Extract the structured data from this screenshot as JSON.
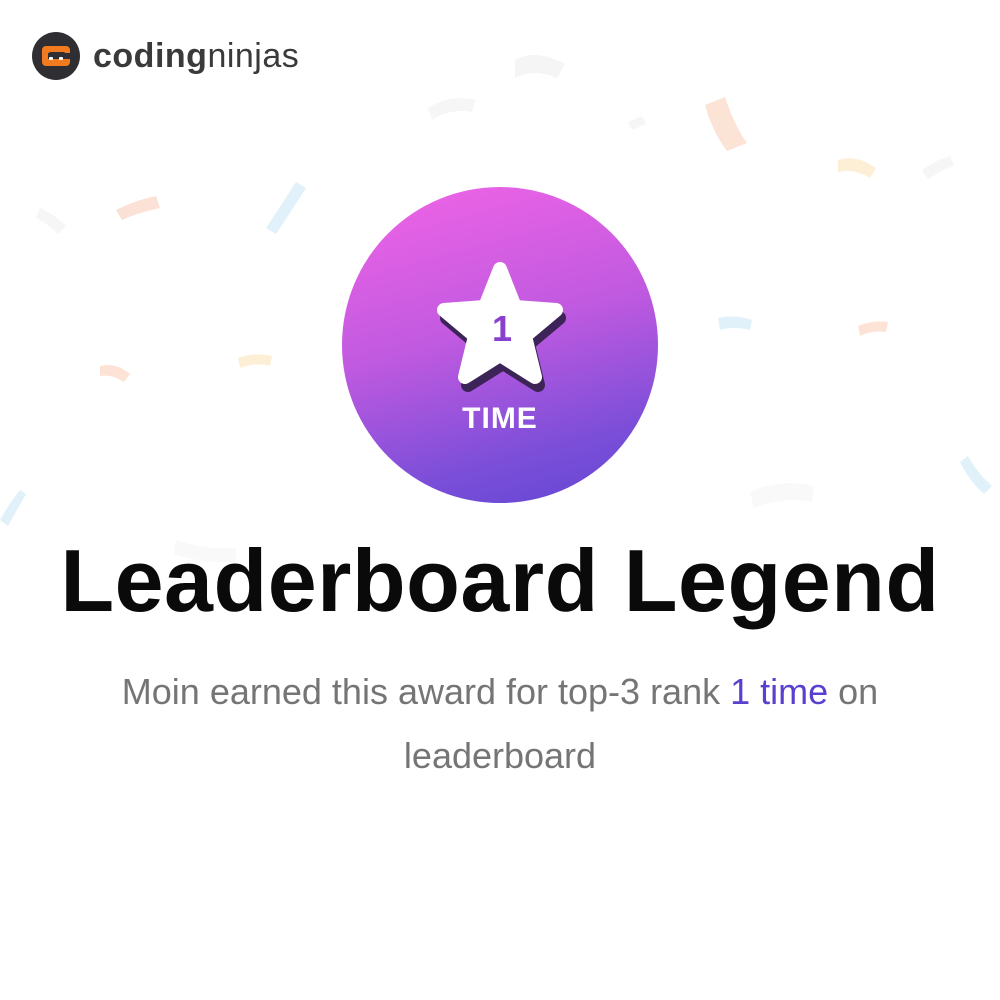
{
  "brand": {
    "name_bold": "coding",
    "name_light": "ninjas",
    "accent_color": "#f27b1f",
    "icon": "ninja-logo-icon"
  },
  "badge": {
    "count": "1",
    "label": "TIME",
    "icon": "star-icon",
    "gradient_top": "#f264e6",
    "gradient_bottom": "#6146d4"
  },
  "title": "Leaderboard Legend",
  "description": {
    "prefix": "Moin earned this award for top-3 rank ",
    "highlight": "1 time",
    "suffix": " on leaderboard",
    "highlight_color": "#5b3fd0"
  }
}
